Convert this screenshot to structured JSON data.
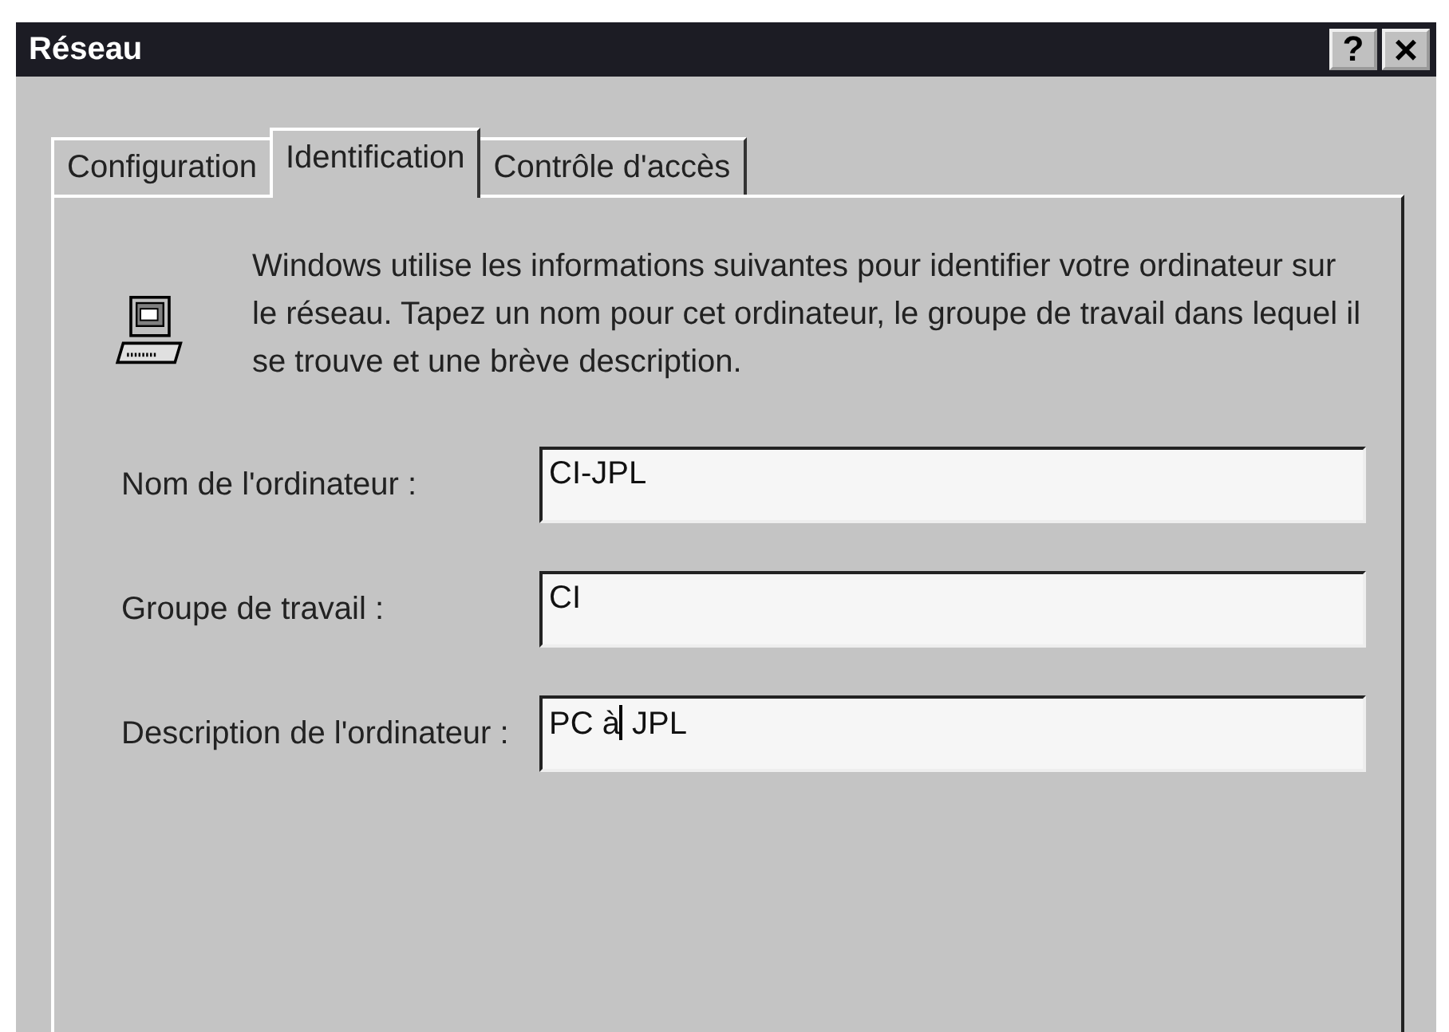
{
  "window": {
    "title": "Réseau",
    "buttons": [
      {
        "kind": "help",
        "label": "?"
      },
      {
        "kind": "close",
        "label": "×"
      }
    ]
  },
  "tabs": [
    {
      "label": "Configuration",
      "selected": false
    },
    {
      "label": "Identification",
      "selected": true
    },
    {
      "label": "Contrôle d'accès",
      "selected": false
    }
  ],
  "intro": "Windows utilise les informations suivantes pour identifier votre ordinateur sur le réseau. Tapez un nom pour cet ordinateur, le groupe de travail dans lequel il se trouve et une brève description.",
  "fields": [
    {
      "label": "Nom de l'ordinateur :",
      "value": "CI-JPL"
    },
    {
      "label": "Groupe de travail :",
      "value": "CI"
    },
    {
      "label": "Description de l'ordinateur :",
      "value": "PC à",
      "value_after_caret": " JPL"
    }
  ]
}
